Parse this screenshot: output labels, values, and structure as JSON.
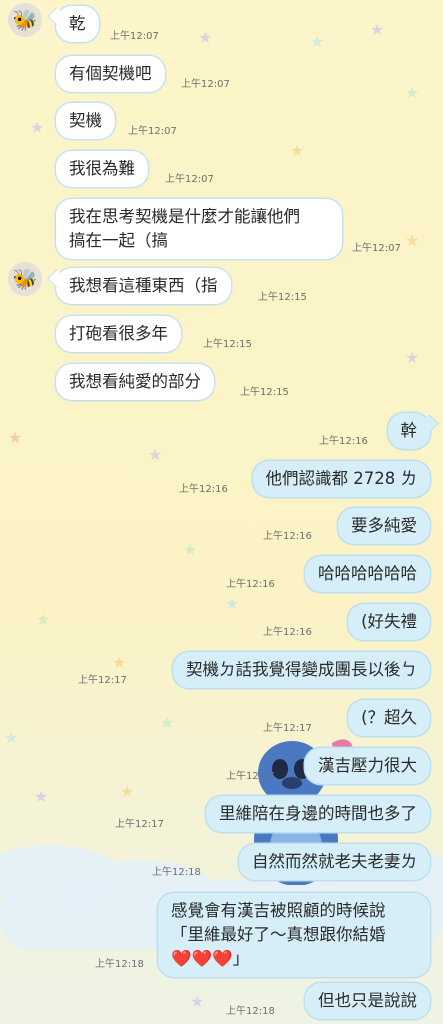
{
  "avatar_icon": "bee-avatar-icon",
  "accent_colors": {
    "incoming_bubble": "#ffffff",
    "outgoing_bubble": "#d6eef8",
    "background": "#fbf5c9"
  },
  "messages": [
    {
      "text": "乾",
      "time": "上午12:07"
    },
    {
      "text": "有個契機吧",
      "time": "上午12:07"
    },
    {
      "text": "契機",
      "time": "上午12:07"
    },
    {
      "text": "我很為難",
      "time": "上午12:07"
    },
    {
      "text_line1": "我在思考契機是什麼才能讓他們",
      "text_line2": "搞在一起（搞",
      "time": "上午12:07"
    },
    {
      "text": "我想看這種東西（指",
      "time": "上午12:15"
    },
    {
      "text": "打砲看很多年",
      "time": "上午12:15"
    },
    {
      "text": "我想看純愛的部分",
      "time": "上午12:15"
    },
    {
      "text": "幹",
      "time": "上午12:16"
    },
    {
      "text": "他們認識都 2728 ㄌ",
      "time": "上午12:16"
    },
    {
      "text": "要多純愛",
      "time": "上午12:16"
    },
    {
      "text": "哈哈哈哈哈哈",
      "time": "上午12:16"
    },
    {
      "text": "(好失禮",
      "time": "上午12:16"
    },
    {
      "text": "契機ㄉ話我覺得變成團長以後ㄅ",
      "time": "上午12:17"
    },
    {
      "text": "(？超久",
      "time": "上午12:17"
    },
    {
      "text": "漢吉壓力很大",
      "time": "上午12:17"
    },
    {
      "text": "里維陪在身邊的時間也多了",
      "time": "上午12:17"
    },
    {
      "text": "自然而然就老夫老妻ㄌ",
      "time": "上午12:18"
    },
    {
      "text_line1": "感覺會有漢吉被照顧的時候說",
      "text_line2": "「里維最好了～真想跟你結婚",
      "hearts": "❤️❤️❤️",
      "text_end": "」",
      "time": "上午12:18"
    },
    {
      "text": "但也只是說說",
      "time": "上午12:18"
    }
  ]
}
